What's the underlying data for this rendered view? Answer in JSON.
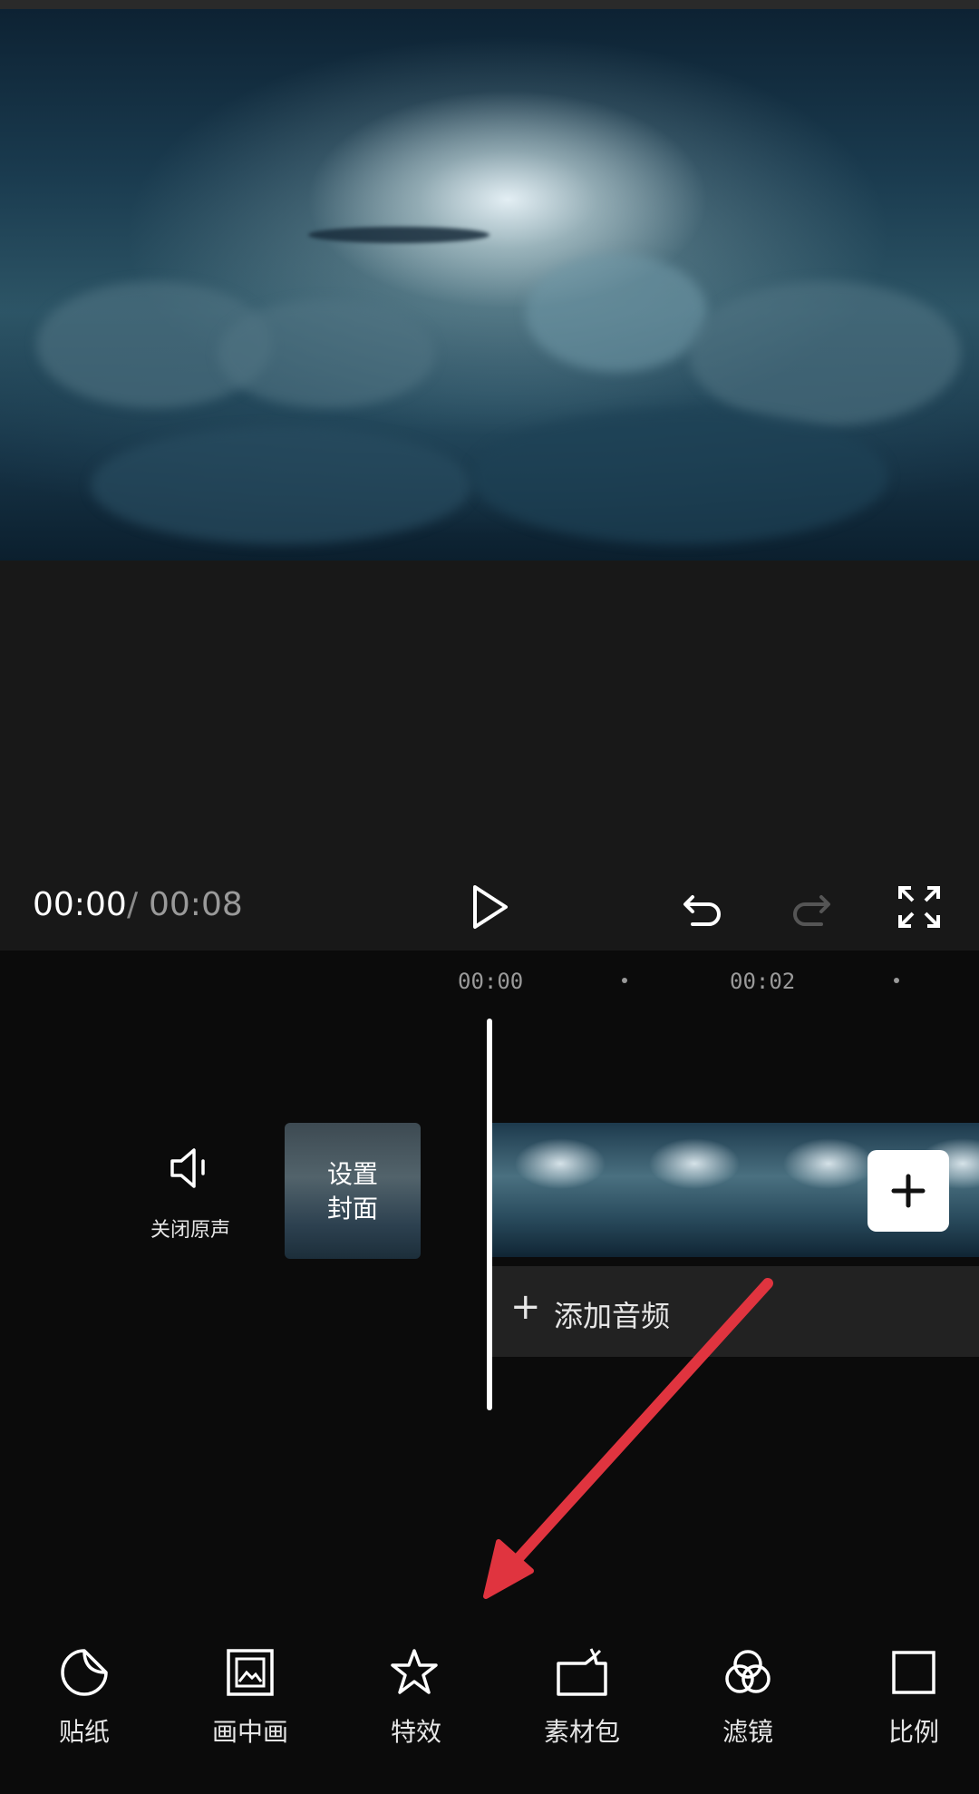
{
  "player": {
    "current_time": "00:00",
    "separator": "/",
    "total_time": "00:08"
  },
  "timeline": {
    "ruler": [
      "00:00",
      "00:02"
    ],
    "mute_label": "关闭原声",
    "cover_label_line1": "设置",
    "cover_label_line2": "封面",
    "add_audio_label": "添加音频"
  },
  "toolbar": {
    "items": [
      {
        "label": "贴纸",
        "icon": "sticker-icon"
      },
      {
        "label": "画中画",
        "icon": "picture-in-picture-icon"
      },
      {
        "label": "特效",
        "icon": "effects-star-icon"
      },
      {
        "label": "素材包",
        "icon": "material-pack-icon"
      },
      {
        "label": "滤镜",
        "icon": "filter-icon"
      },
      {
        "label": "比例",
        "icon": "ratio-icon"
      }
    ]
  },
  "colors": {
    "background": "#0b0b0b",
    "panel": "#181818",
    "annotation_arrow": "#e0343f"
  }
}
